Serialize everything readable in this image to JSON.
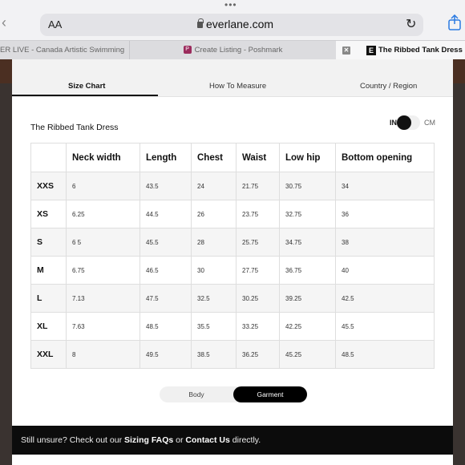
{
  "browser": {
    "text_size_label": "AA",
    "url": "everlane.com"
  },
  "tabs": [
    {
      "label": "ER LIVE - Canada Artistic Swimming"
    },
    {
      "label": "Create Listing - Poshmark"
    },
    {
      "label": "The Ribbed Tank Dress Bla"
    }
  ],
  "modal": {
    "tabs": [
      {
        "label": "Size Chart"
      },
      {
        "label": "How To Measure"
      },
      {
        "label": "Country / Region"
      }
    ],
    "product_title": "The Ribbed Tank Dress",
    "unit_in": "IN",
    "unit_cm": "CM",
    "table": {
      "headers": [
        "",
        "Neck width",
        "Length",
        "Chest",
        "Waist",
        "Low hip",
        "Bottom opening"
      ],
      "rows": [
        [
          "XXS",
          "6",
          "43.5",
          "24",
          "21.75",
          "30.75",
          "34"
        ],
        [
          "XS",
          "6.25",
          "44.5",
          "26",
          "23.75",
          "32.75",
          "36"
        ],
        [
          "S",
          "6 5",
          "45.5",
          "28",
          "25.75",
          "34.75",
          "38"
        ],
        [
          "M",
          "6.75",
          "46.5",
          "30",
          "27.75",
          "36.75",
          "40"
        ],
        [
          "L",
          "7.13",
          "47.5",
          "32.5",
          "30.25",
          "39.25",
          "42.5"
        ],
        [
          "XL",
          "7.63",
          "48.5",
          "35.5",
          "33.25",
          "42.25",
          "45.5"
        ],
        [
          "XXL",
          "8",
          "49.5",
          "38.5",
          "36.25",
          "45.25",
          "48.5"
        ]
      ]
    },
    "toggle": {
      "body": "Body",
      "garment": "Garment"
    },
    "footer": {
      "prefix": "Still unsure? Check out our ",
      "faq": "Sizing FAQs",
      "or": " or ",
      "contact": "Contact Us",
      "suffix": " directly."
    }
  }
}
